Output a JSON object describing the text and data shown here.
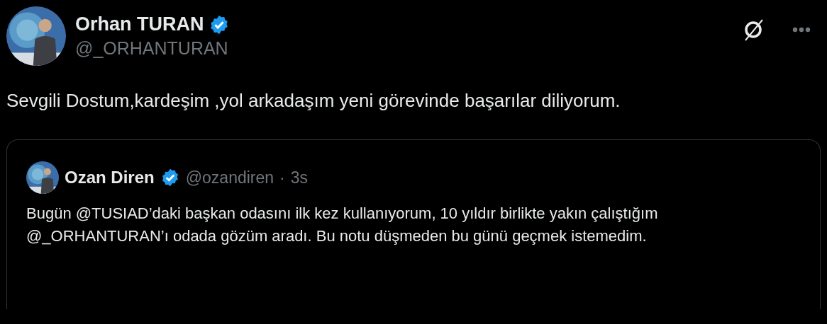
{
  "author": {
    "name": "Orhan TURAN",
    "verified": true,
    "handle": "@_ORHANTURAN"
  },
  "text": "Sevgili Dostum,kardeşim ,yol arkadaşım yeni görevinde başarılar diliyorum.",
  "quoted": {
    "name": "Ozan Diren",
    "verified": true,
    "handle": "@ozandiren",
    "separator": "·",
    "time": "3s",
    "text": "Bugün @TUSIAD’daki başkan odasını ilk kez kullanıyorum, 10 yıldır birlikte yakın çalıştığım @_ORHANTURAN’ı odada gözüm aradı. Bu notu düşmeden bu günü geçmek istemedim."
  }
}
